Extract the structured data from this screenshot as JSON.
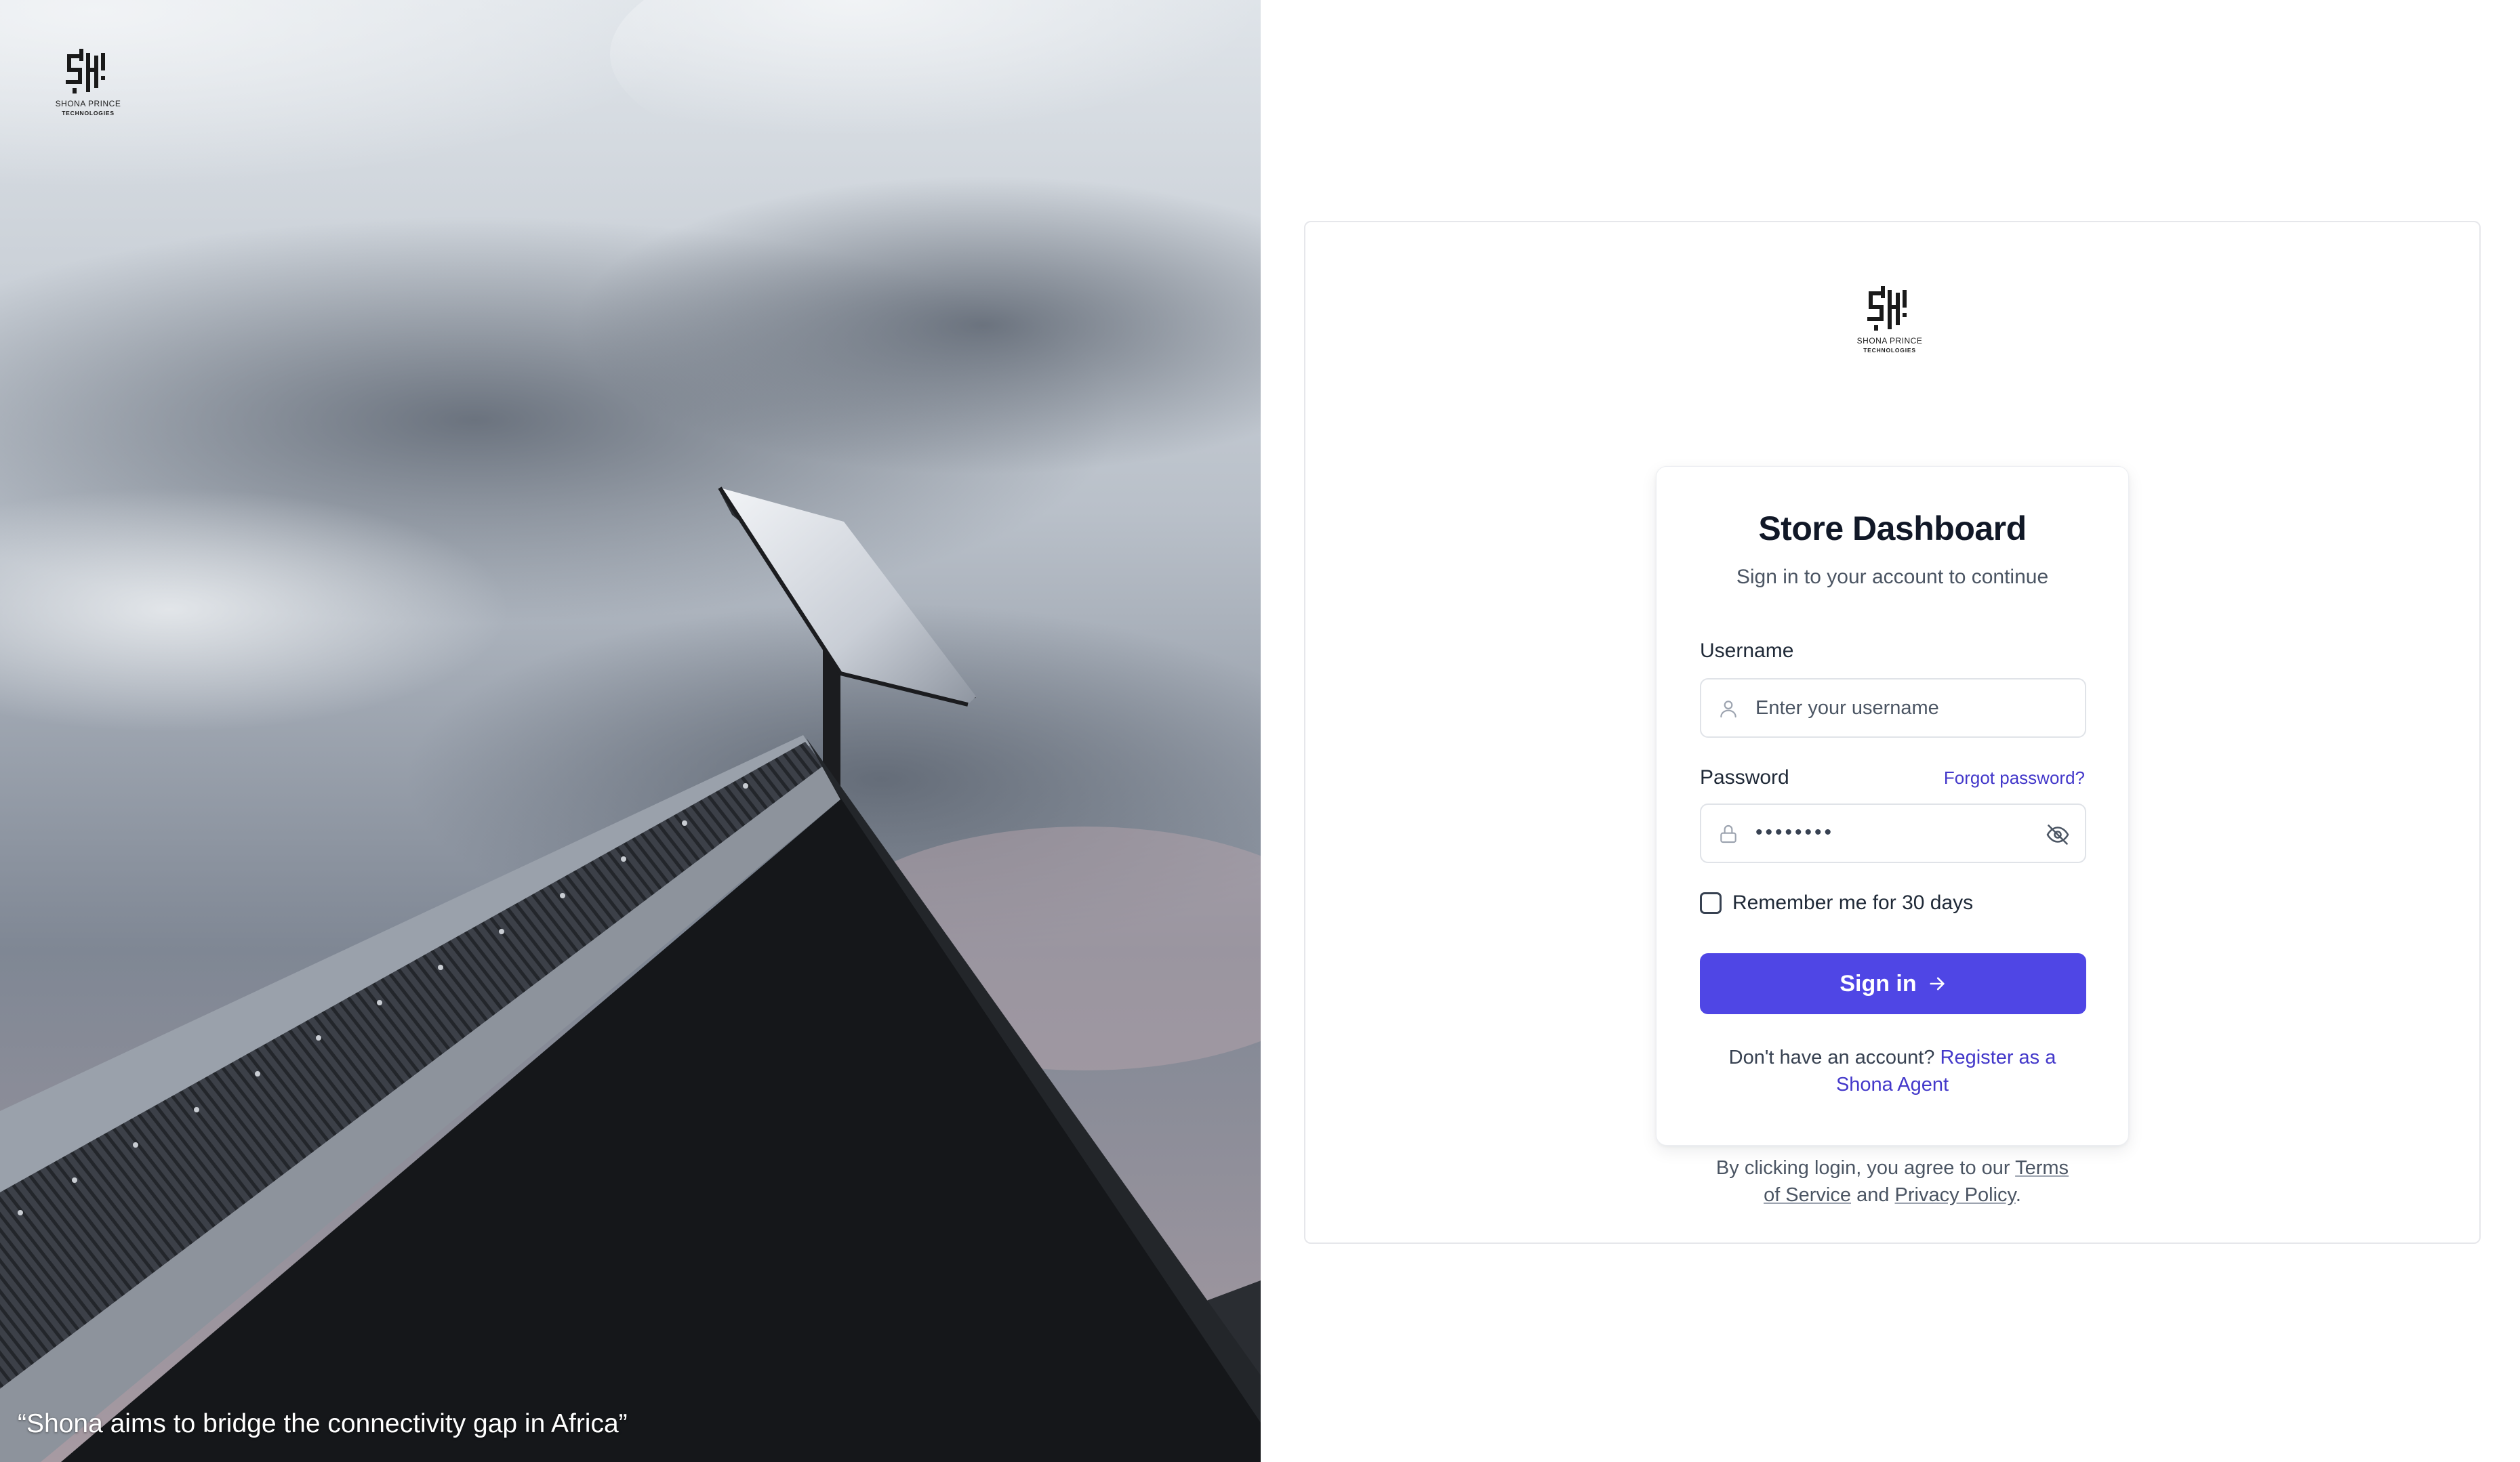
{
  "brand": {
    "name_line1": "SHONA PRINCE",
    "name_line2": "TECHNOLOGIES",
    "monogram": "SPH-logo-icon"
  },
  "hero": {
    "quote": "“Shona aims to bridge the connectivity gap in Africa”",
    "image": "satellite-dish-on-roof-photo"
  },
  "login": {
    "title": "Store Dashboard",
    "subtitle": "Sign in to your account to continue",
    "username_label": "Username",
    "username_placeholder": "Enter your username",
    "password_label": "Password",
    "forgot_label": "Forgot password?",
    "password_masked": "••••••••",
    "remember_label": "Remember me for 30 days",
    "remember_checked": false,
    "signin_label": "Sign in",
    "register_prompt": "Don't have an account?",
    "register_link_line1": "Register as a",
    "register_link_line2": "Shona Agent"
  },
  "terms": {
    "prefix": "By clicking login, you agree to our",
    "terms_line1": "Terms",
    "terms_line2": "of Service",
    "and": "and",
    "privacy": "Privacy Policy",
    "suffix": "."
  },
  "colors": {
    "accent": "#4f46e5",
    "link": "#4338ca",
    "title": "#111827",
    "muted": "#4b5563",
    "border": "#e0e3e8"
  }
}
